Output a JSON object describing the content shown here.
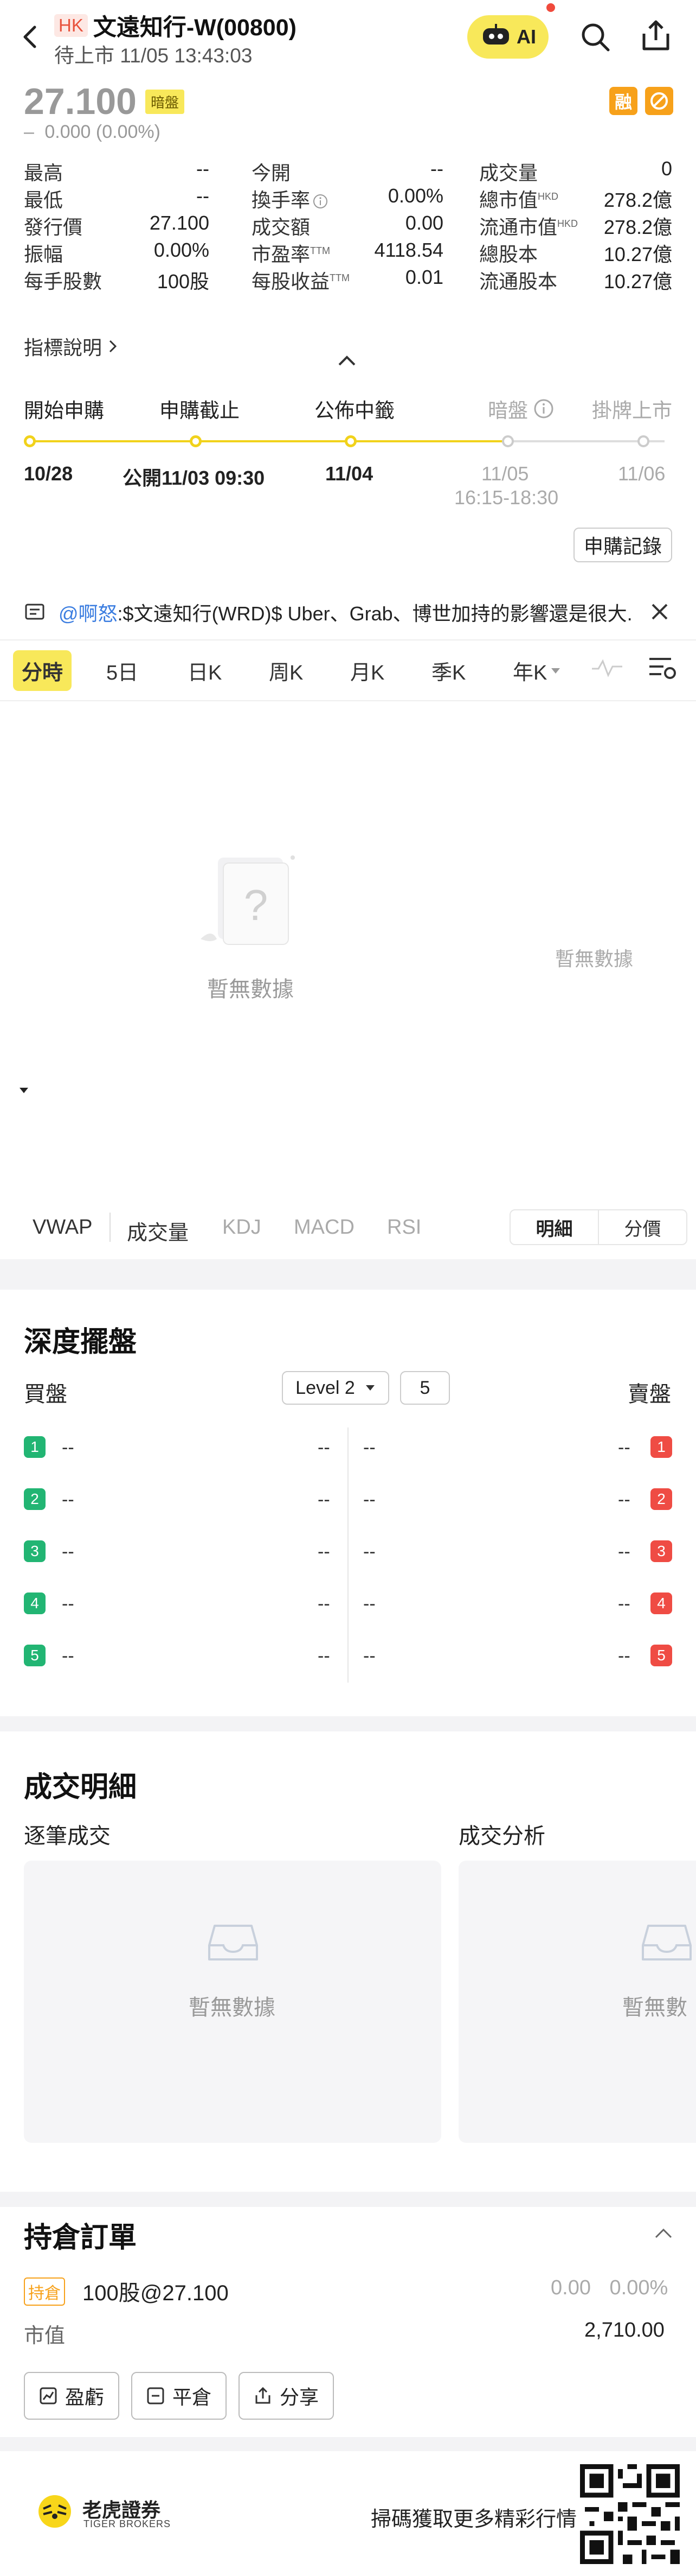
{
  "header": {
    "market": "HK",
    "title": "文遠知行-W(00800)",
    "subtitle": "待上市 11/05 13:43:03",
    "ai_label": "AI"
  },
  "quote": {
    "price": "27.100",
    "badge": "暗盤",
    "change": "0.000 (0.00%)",
    "change_sign": "–",
    "tag_margin": "融"
  },
  "stats": [
    [
      {
        "label": "最高",
        "value": "--"
      },
      {
        "label": "今開",
        "value": "--"
      },
      {
        "label": "成交量",
        "value": "0"
      }
    ],
    [
      {
        "label": "最低",
        "value": "--"
      },
      {
        "label": "換手率",
        "value": "0.00%"
      },
      {
        "label": "總市值",
        "sup": "HKD",
        "value": "278.2億"
      }
    ],
    [
      {
        "label": "發行價",
        "value": "27.100"
      },
      {
        "label": "成交額",
        "value": "0.00"
      },
      {
        "label": "流通市值",
        "sup": "HKD",
        "value": "278.2億"
      }
    ],
    [
      {
        "label": "振幅",
        "value": "0.00%"
      },
      {
        "label": "市盈率",
        "sup": "TTM",
        "value": "4118.54"
      },
      {
        "label": "總股本",
        "value": "10.27億"
      }
    ],
    [
      {
        "label": "每手股數",
        "value": "100股"
      },
      {
        "label": "每股收益",
        "sup": "TTM",
        "value": "0.01"
      },
      {
        "label": "流通股本",
        "value": "10.27億"
      }
    ]
  ],
  "indicator_link": "指標說明",
  "ipo": {
    "steps": [
      "開始申購",
      "申購截止",
      "公佈中籤",
      "暗盤",
      "掛牌上市"
    ],
    "dates": [
      "10/28",
      "公開11/03 09:30",
      "11/04",
      "11/05",
      "11/06"
    ],
    "dark_time": "16:15-18:30",
    "record_btn": "申購記錄"
  },
  "news": {
    "user": "@啊怒",
    "text": ":$文遠知行(WRD)$ Uber、Grab、博世加持的影響還是很大..."
  },
  "chart_tabs": [
    "分時",
    "5日",
    "日K",
    "周K",
    "月K",
    "季K",
    "年K"
  ],
  "chart": {
    "empty_main": "暫無數據",
    "empty_side": "暫無數據",
    "indicators": [
      "VWAP",
      "成交量",
      "KDJ",
      "MACD",
      "RSI"
    ],
    "detail_tabs": [
      "明細",
      "分價"
    ]
  },
  "depth": {
    "title": "深度擺盤",
    "bid": "買盤",
    "ask": "賣盤",
    "level": "Level 2",
    "count": "5",
    "rows": [
      "1",
      "2",
      "3",
      "4",
      "5"
    ],
    "dash": "--"
  },
  "trades": {
    "title": "成交明細",
    "left": "逐筆成交",
    "right": "成交分析",
    "empty": "暫無數據",
    "empty_right": "暫無數"
  },
  "position": {
    "title": "持倉訂單",
    "tag": "持倉",
    "qty": "100股@27.100",
    "pnl": "0.00",
    "pnl_pct": "0.00%",
    "mv_label": "市值",
    "mv_value": "2,710.00",
    "buttons": [
      "盈虧",
      "平倉",
      "分享"
    ]
  },
  "footer": {
    "brand": "老虎證券",
    "brand_en": "TIGER BROKERS",
    "slogan": "掃碼獲取更多精彩行情"
  }
}
